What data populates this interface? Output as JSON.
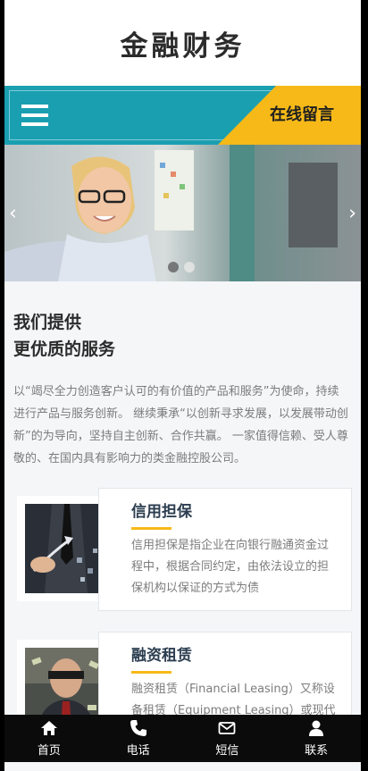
{
  "header": {
    "logo": "金融财务"
  },
  "nav": {
    "menu_icon": "hamburger-menu-icon",
    "message_link": "在线留言"
  },
  "slider": {
    "prev_icon": "chevron-left-icon",
    "next_icon": "chevron-right-icon",
    "slide_count": 2,
    "active_slide": 2
  },
  "intro": {
    "title_line1": "我们提供",
    "title_line2": "更优质的服务",
    "text": "以“竭尽全力创造客户认可的有价值的产品和服务”为使命，持续进行产品与服务创新。 继续秉承“以创新寻求发展，以发展带动创新”的为导向，坚持自主创新、合作共赢。 一家值得信赖、受人尊敬的、在国内具有影响力的类金融控股公司。"
  },
  "services": [
    {
      "title": "信用担保",
      "text": "信用担保是指企业在向银行融通资金过程中，根据合同约定，由依法设立的担保机构以保证的方式为债"
    },
    {
      "title": "融资租赁",
      "text": "融资租赁（Financial Leasing）又称设备租赁（Equipment Leasing）或现代租赁"
    }
  ],
  "tabbar": [
    {
      "label": "首页",
      "icon": "home-icon"
    },
    {
      "label": "电话",
      "icon": "phone-icon"
    },
    {
      "label": "短信",
      "icon": "envelope-icon"
    },
    {
      "label": "联系",
      "icon": "user-icon"
    }
  ],
  "colors": {
    "teal": "#1a9fb1",
    "accent": "#f6b918",
    "tabbar_bg": "#0b0b0b"
  }
}
